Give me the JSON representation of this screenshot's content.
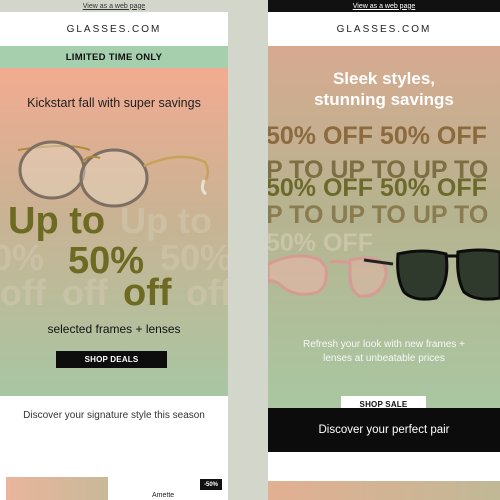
{
  "left_email": {
    "top_link": "View as a web page",
    "logo": "GLASSES.COM",
    "ribbon": "LIMITED TIME ONLY",
    "headline": "Kickstart fall with super savings",
    "offer": {
      "line1": "Up to",
      "line2": "50%",
      "line3": "off"
    },
    "ghost_text": [
      "Up to",
      "50%",
      "0%",
      "off",
      "off",
      "off"
    ],
    "subhead": "selected frames + lenses",
    "cta": "SHOP DEALS",
    "section_text": "Discover your signature style this season",
    "badge": "-50%",
    "product_name": "Amette"
  },
  "right_email": {
    "top_link": "View as a web page",
    "logo": "GLASSES.COM",
    "headline_line1": "Sleek styles,",
    "headline_line2": "stunning savings",
    "repeat_rows": [
      "50% OFF 50% OFF",
      "P TO UP TO UP TO",
      "50% OFF 50% OFF",
      "P TO UP TO UP TO",
      "50% OFF"
    ],
    "body_line1": "Refresh your look with new frames +",
    "body_line2": "lenses at unbeatable prices",
    "cta": "SHOP SALE",
    "banner": "Discover your perfect pair"
  },
  "colors": {
    "page_bg": "#d3d6cb",
    "ribbon_green": "#a6cfae",
    "offer_olive": "#6d6b23",
    "cta_black": "#0d0d0d"
  }
}
